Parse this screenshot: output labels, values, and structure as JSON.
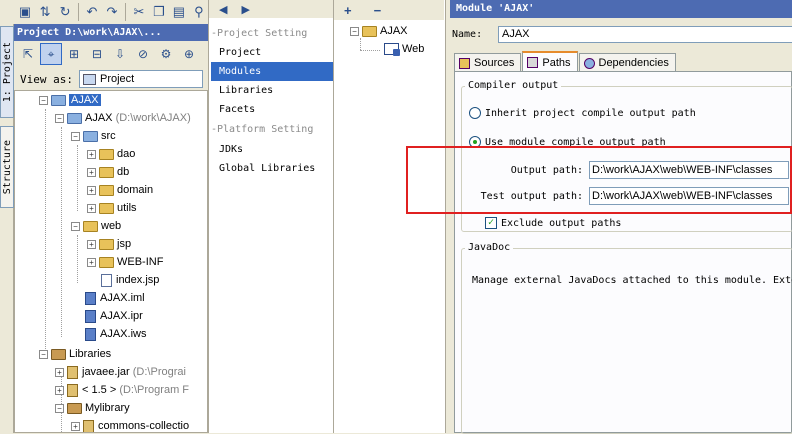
{
  "toolbar": {
    "icons": [
      "save-icon",
      "sync-icon",
      "refresh-icon",
      "undo-icon",
      "redo-icon",
      "cut-icon",
      "copy-icon",
      "paste-icon",
      "find-icon"
    ]
  },
  "side_tabs": {
    "project": "1: Project",
    "structure": "Structure"
  },
  "project_panel": {
    "title": "Project  D:\\work\\AJAX\\...",
    "view_as_label": "View as:",
    "view_as_value": "Project",
    "tree": {
      "root": "AJAX",
      "module": "AJAX",
      "module_path": "(D:\\work\\AJAX)",
      "src": "src",
      "src_children": [
        "dao",
        "db",
        "domain",
        "utils"
      ],
      "web": "web",
      "web_children": [
        "jsp",
        "WEB-INF"
      ],
      "index": "index.jsp",
      "files": [
        "AJAX.iml",
        "AJAX.ipr",
        "AJAX.iws"
      ],
      "libraries": "Libraries",
      "javaee": "javaee.jar",
      "javaee_path": "(D:\\Prograi",
      "jdk": "< 1.5 >",
      "jdk_path": "(D:\\Program F",
      "mylibrary": "Mylibrary",
      "commons": "commons-collectio"
    }
  },
  "settings": {
    "categories": {
      "project_header": "-Project Setting",
      "project": "Project",
      "modules": "Modules",
      "libraries": "Libraries",
      "facets": "Facets",
      "platform_header": "-Platform Setting",
      "jdks": "JDKs",
      "global_libraries": "Global Libraries"
    },
    "module_tree": {
      "module": "AJAX",
      "facet": "Web"
    }
  },
  "module": {
    "title": "Module 'AJAX'",
    "name_label": "Name:",
    "name_value": "AJAX",
    "tabs": [
      "Sources",
      "Paths",
      "Dependencies"
    ],
    "compiler_output_title": "Compiler output",
    "inherit_label": "Inherit project compile output path",
    "use_module_label": "Use module compile output path",
    "output_path_label": "Output path:",
    "output_path_value": "D:\\work\\AJAX\\web\\WEB-INF\\classes",
    "test_output_path_label": "Test output path:",
    "test_output_path_value": "D:\\work\\AJAX\\web\\WEB-INF\\classes",
    "exclude_label": "Exclude output paths",
    "javadoc_title": "JavaDoc",
    "javadoc_text": "Manage external JavaDocs attached to this module. Exte"
  }
}
